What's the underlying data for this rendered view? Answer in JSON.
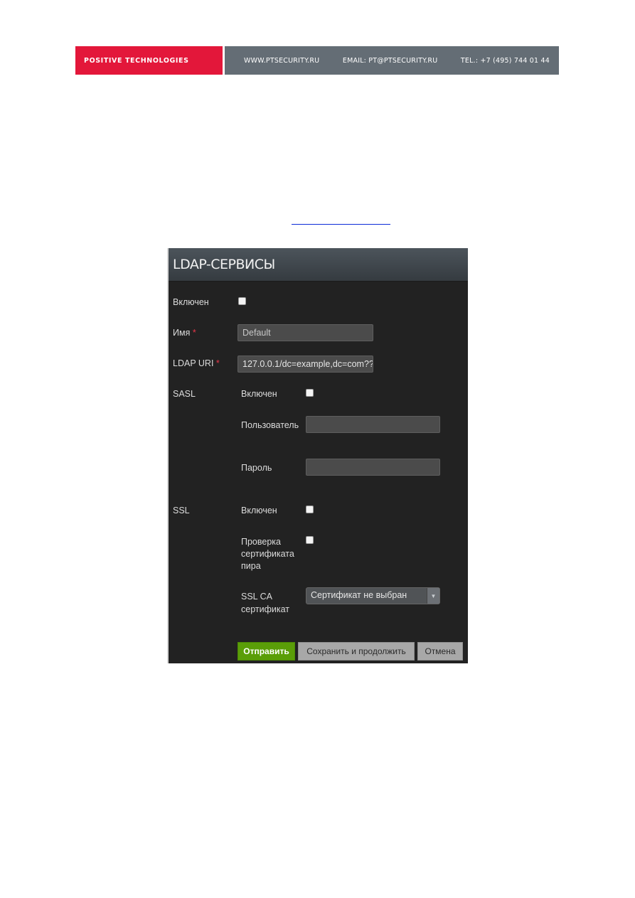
{
  "banner": {
    "brand": "POSITIVE TECHNOLOGIES",
    "website": "WWW.PTSECURITY.RU",
    "email": "EMAIL: PT@PTSECURITY.RU",
    "phone": "TEL.: +7 (495) 744 01 44",
    "brand_color": "#e3173a",
    "bar_color": "#646d75"
  },
  "panel": {
    "title": "LDAP-СЕРВИСЫ",
    "fields": {
      "enabled_label": "Включен",
      "name_label": "Имя",
      "name_value": "Default",
      "uri_label": "LDAP URI",
      "uri_value": "127.0.0.1/dc=example,dc=com??",
      "required_mark": "*"
    },
    "sasl": {
      "section_label": "SASL",
      "enabled_label": "Включен",
      "user_label": "Пользователь",
      "user_value": "",
      "password_label": "Пароль",
      "password_value": ""
    },
    "ssl": {
      "section_label": "SSL",
      "enabled_label": "Включен",
      "peer_check_line1": "Проверка",
      "peer_check_line2": "сертификата",
      "peer_check_line3": "пира",
      "ca_label_line1": "SSL CA",
      "ca_label_line2": "сертификат",
      "ca_selected": "Сертификат не выбран"
    },
    "buttons": {
      "submit": "Отправить",
      "save_continue": "Сохранить и продолжить",
      "cancel": "Отмена"
    },
    "colors": {
      "submit": "#5a9e08",
      "required": "#e8364a"
    }
  }
}
